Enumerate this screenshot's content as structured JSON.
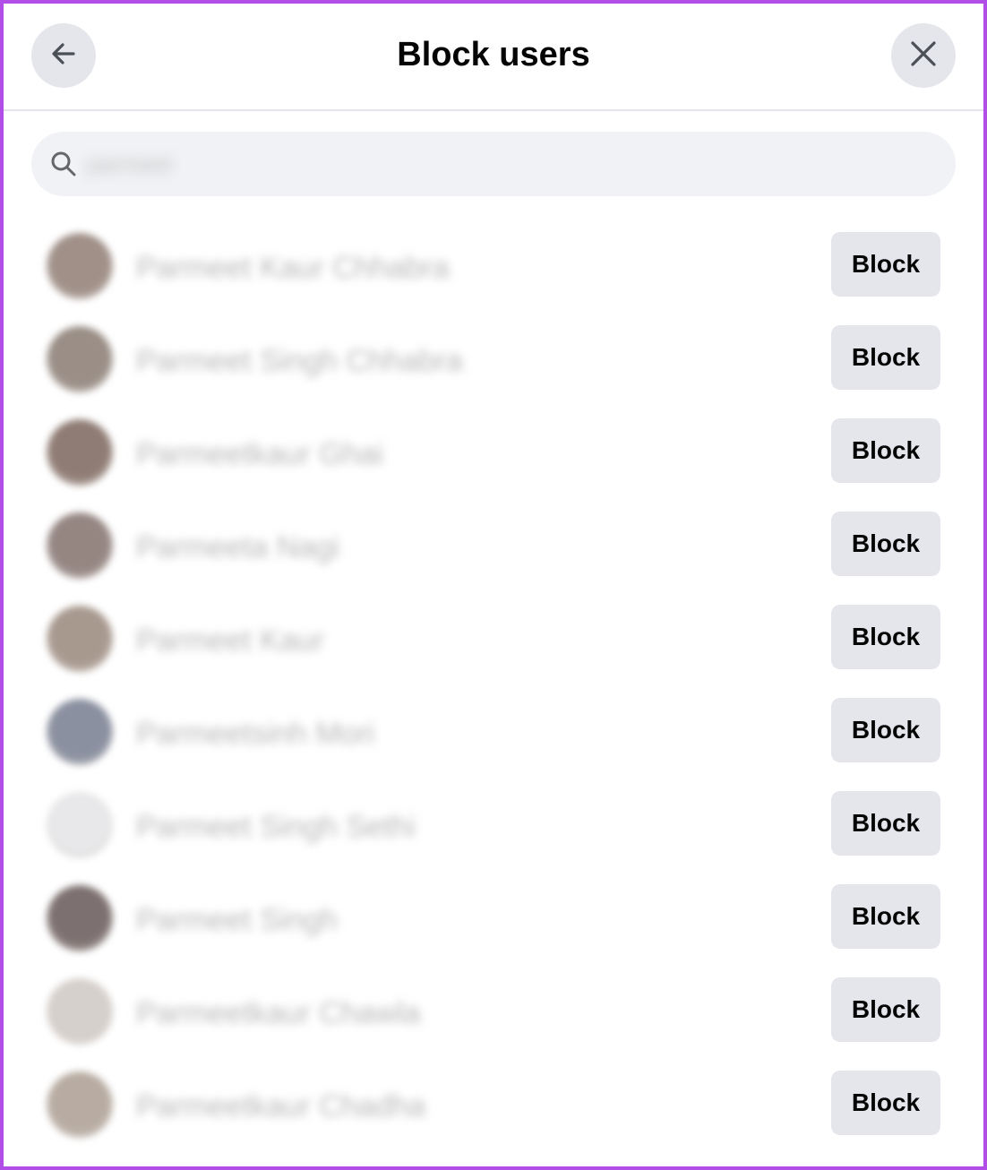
{
  "header": {
    "title": "Block users",
    "back_icon": "arrow-left-icon",
    "close_icon": "close-icon"
  },
  "search": {
    "icon": "search-icon",
    "value": "parmeet"
  },
  "users": [
    {
      "name": "Parmeet Kaur Chhabra",
      "block_label": "Block",
      "avatar_color": "#a09088"
    },
    {
      "name": "Parmeet Singh Chhabra",
      "block_label": "Block",
      "avatar_color": "#9a8e86"
    },
    {
      "name": "Parmeetkaur Ghai",
      "block_label": "Block",
      "avatar_color": "#8f7c74"
    },
    {
      "name": "Parmeeta Nagi",
      "block_label": "Block",
      "avatar_color": "#958682"
    },
    {
      "name": "Parmeet Kaur",
      "block_label": "Block",
      "avatar_color": "#a8998f"
    },
    {
      "name": "Parmeetsinh Mori",
      "block_label": "Block",
      "avatar_color": "#8a90a0"
    },
    {
      "name": "Parmeet Singh Sethi",
      "block_label": "Block",
      "avatar_color": "#e8e8ea"
    },
    {
      "name": "Parmeet Singh",
      "block_label": "Block",
      "avatar_color": "#7d7070"
    },
    {
      "name": "Parmeetkaur Chawla",
      "block_label": "Block",
      "avatar_color": "#d6d0cc"
    },
    {
      "name": "Parmeetkaur Chadha",
      "block_label": "Block",
      "avatar_color": "#b8aca2"
    }
  ]
}
